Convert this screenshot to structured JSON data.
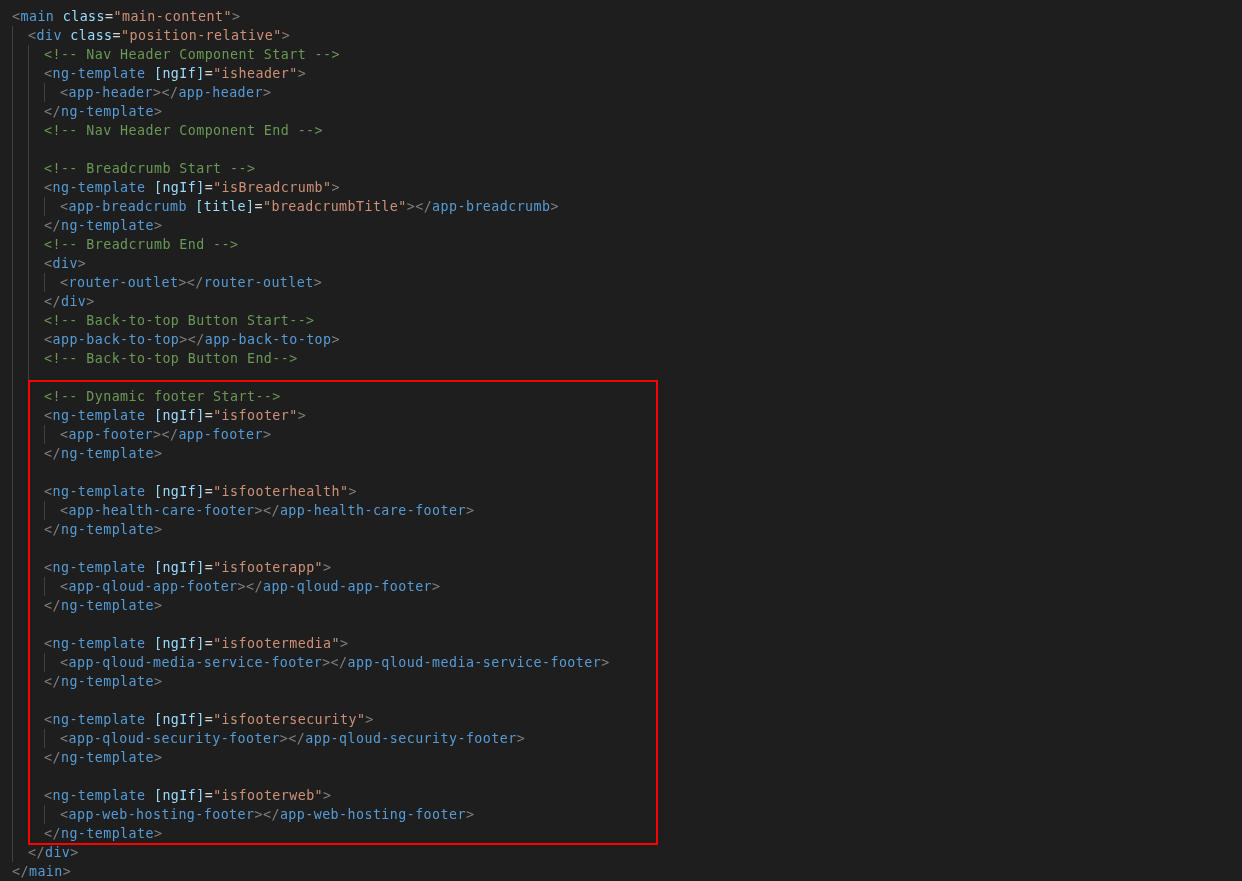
{
  "code": [
    {
      "kind": "line",
      "tokens": [
        {
          "kind": "punct",
          "s": "<"
        },
        {
          "kind": "tag",
          "s": "main"
        },
        {
          "kind": "attr",
          "s": " class"
        },
        {
          "kind": "eq",
          "s": "="
        },
        {
          "kind": "str",
          "s": "\"main-content\""
        },
        {
          "kind": "punct",
          "s": ">"
        }
      ],
      "children": [
        {
          "kind": "line",
          "tokens": [
            {
              "kind": "punct",
              "s": "<"
            },
            {
              "kind": "tag",
              "s": "div"
            },
            {
              "kind": "attr",
              "s": " class"
            },
            {
              "kind": "eq",
              "s": "="
            },
            {
              "kind": "str",
              "s": "\"position-relative\""
            },
            {
              "kind": "punct",
              "s": ">"
            }
          ],
          "children": [
            {
              "kind": "line",
              "tokens": [
                {
                  "kind": "comment",
                  "s": "<!-- Nav Header Component Start -->"
                }
              ]
            },
            {
              "kind": "line",
              "tokens": [
                {
                  "kind": "punct",
                  "s": "<"
                },
                {
                  "kind": "tag",
                  "s": "ng-template"
                },
                {
                  "kind": "attr",
                  "s": " [ngIf]"
                },
                {
                  "kind": "eq",
                  "s": "="
                },
                {
                  "kind": "str",
                  "s": "\"isheader\""
                },
                {
                  "kind": "punct",
                  "s": ">"
                }
              ],
              "children": [
                {
                  "kind": "line",
                  "tokens": [
                    {
                      "kind": "punct",
                      "s": "<"
                    },
                    {
                      "kind": "tag",
                      "s": "app-header"
                    },
                    {
                      "kind": "punct",
                      "s": "></"
                    },
                    {
                      "kind": "tag",
                      "s": "app-header"
                    },
                    {
                      "kind": "punct",
                      "s": ">"
                    }
                  ]
                }
              ]
            },
            {
              "kind": "line",
              "tokens": [
                {
                  "kind": "punct",
                  "s": "</"
                },
                {
                  "kind": "tag",
                  "s": "ng-template"
                },
                {
                  "kind": "punct",
                  "s": ">"
                }
              ]
            },
            {
              "kind": "line",
              "tokens": [
                {
                  "kind": "comment",
                  "s": "<!-- Nav Header Component End -->"
                }
              ]
            },
            {
              "kind": "blank"
            },
            {
              "kind": "line",
              "tokens": [
                {
                  "kind": "comment",
                  "s": "<!-- Breadcrumb Start -->"
                }
              ]
            },
            {
              "kind": "line",
              "tokens": [
                {
                  "kind": "punct",
                  "s": "<"
                },
                {
                  "kind": "tag",
                  "s": "ng-template"
                },
                {
                  "kind": "attr",
                  "s": " [ngIf]"
                },
                {
                  "kind": "eq",
                  "s": "="
                },
                {
                  "kind": "str",
                  "s": "\"isBreadcrumb\""
                },
                {
                  "kind": "punct",
                  "s": ">"
                }
              ],
              "children": [
                {
                  "kind": "line",
                  "tokens": [
                    {
                      "kind": "punct",
                      "s": "<"
                    },
                    {
                      "kind": "tag",
                      "s": "app-breadcrumb"
                    },
                    {
                      "kind": "attr",
                      "s": " [title]"
                    },
                    {
                      "kind": "eq",
                      "s": "="
                    },
                    {
                      "kind": "str",
                      "s": "\"breadcrumbTitle\""
                    },
                    {
                      "kind": "punct",
                      "s": "></"
                    },
                    {
                      "kind": "tag",
                      "s": "app-breadcrumb"
                    },
                    {
                      "kind": "punct",
                      "s": ">"
                    }
                  ]
                }
              ]
            },
            {
              "kind": "line",
              "tokens": [
                {
                  "kind": "punct",
                  "s": "</"
                },
                {
                  "kind": "tag",
                  "s": "ng-template"
                },
                {
                  "kind": "punct",
                  "s": ">"
                }
              ]
            },
            {
              "kind": "line",
              "tokens": [
                {
                  "kind": "comment",
                  "s": "<!-- Breadcrumb End -->"
                }
              ]
            },
            {
              "kind": "line",
              "tokens": [
                {
                  "kind": "punct",
                  "s": "<"
                },
                {
                  "kind": "tag",
                  "s": "div"
                },
                {
                  "kind": "punct",
                  "s": ">"
                }
              ],
              "children": [
                {
                  "kind": "line",
                  "tokens": [
                    {
                      "kind": "punct",
                      "s": "<"
                    },
                    {
                      "kind": "tag",
                      "s": "router-outlet"
                    },
                    {
                      "kind": "punct",
                      "s": "></"
                    },
                    {
                      "kind": "tag",
                      "s": "router-outlet"
                    },
                    {
                      "kind": "punct",
                      "s": ">"
                    }
                  ]
                }
              ]
            },
            {
              "kind": "line",
              "tokens": [
                {
                  "kind": "punct",
                  "s": "</"
                },
                {
                  "kind": "tag",
                  "s": "div"
                },
                {
                  "kind": "punct",
                  "s": ">"
                }
              ]
            },
            {
              "kind": "line",
              "tokens": [
                {
                  "kind": "comment",
                  "s": "<!-- Back-to-top Button Start-->"
                }
              ]
            },
            {
              "kind": "line",
              "tokens": [
                {
                  "kind": "punct",
                  "s": "<"
                },
                {
                  "kind": "tag",
                  "s": "app-back-to-top"
                },
                {
                  "kind": "punct",
                  "s": "></"
                },
                {
                  "kind": "tag",
                  "s": "app-back-to-top"
                },
                {
                  "kind": "punct",
                  "s": ">"
                }
              ]
            },
            {
              "kind": "line",
              "tokens": [
                {
                  "kind": "comment",
                  "s": "<!-- Back-to-top Button End-->"
                }
              ]
            },
            {
              "kind": "blank"
            },
            {
              "kind": "group",
              "highlighted": true,
              "items": [
                {
                  "kind": "line",
                  "tokens": [
                    {
                      "kind": "comment",
                      "s": "<!-- Dynamic footer Start-->"
                    }
                  ]
                },
                {
                  "kind": "line",
                  "tokens": [
                    {
                      "kind": "punct",
                      "s": "<"
                    },
                    {
                      "kind": "tag",
                      "s": "ng-template"
                    },
                    {
                      "kind": "attr",
                      "s": " [ngIf]"
                    },
                    {
                      "kind": "eq",
                      "s": "="
                    },
                    {
                      "kind": "str",
                      "s": "\"isfooter\""
                    },
                    {
                      "kind": "punct",
                      "s": ">"
                    }
                  ],
                  "children": [
                    {
                      "kind": "line",
                      "tokens": [
                        {
                          "kind": "punct",
                          "s": "<"
                        },
                        {
                          "kind": "tag",
                          "s": "app-footer"
                        },
                        {
                          "kind": "punct",
                          "s": "></"
                        },
                        {
                          "kind": "tag",
                          "s": "app-footer"
                        },
                        {
                          "kind": "punct",
                          "s": ">"
                        }
                      ]
                    }
                  ]
                },
                {
                  "kind": "line",
                  "tokens": [
                    {
                      "kind": "punct",
                      "s": "</"
                    },
                    {
                      "kind": "tag",
                      "s": "ng-template"
                    },
                    {
                      "kind": "punct",
                      "s": ">"
                    }
                  ]
                },
                {
                  "kind": "blank"
                },
                {
                  "kind": "line",
                  "tokens": [
                    {
                      "kind": "punct",
                      "s": "<"
                    },
                    {
                      "kind": "tag",
                      "s": "ng-template"
                    },
                    {
                      "kind": "attr",
                      "s": " [ngIf]"
                    },
                    {
                      "kind": "eq",
                      "s": "="
                    },
                    {
                      "kind": "str",
                      "s": "\"isfooterhealth\""
                    },
                    {
                      "kind": "punct",
                      "s": ">"
                    }
                  ],
                  "children": [
                    {
                      "kind": "line",
                      "tokens": [
                        {
                          "kind": "punct",
                          "s": "<"
                        },
                        {
                          "kind": "tag",
                          "s": "app-health-care-footer"
                        },
                        {
                          "kind": "punct",
                          "s": "></"
                        },
                        {
                          "kind": "tag",
                          "s": "app-health-care-footer"
                        },
                        {
                          "kind": "punct",
                          "s": ">"
                        }
                      ]
                    }
                  ]
                },
                {
                  "kind": "line",
                  "tokens": [
                    {
                      "kind": "punct",
                      "s": "</"
                    },
                    {
                      "kind": "tag",
                      "s": "ng-template"
                    },
                    {
                      "kind": "punct",
                      "s": ">"
                    }
                  ]
                },
                {
                  "kind": "blank"
                },
                {
                  "kind": "line",
                  "tokens": [
                    {
                      "kind": "punct",
                      "s": "<"
                    },
                    {
                      "kind": "tag",
                      "s": "ng-template"
                    },
                    {
                      "kind": "attr",
                      "s": " [ngIf]"
                    },
                    {
                      "kind": "eq",
                      "s": "="
                    },
                    {
                      "kind": "str",
                      "s": "\"isfooterapp\""
                    },
                    {
                      "kind": "punct",
                      "s": ">"
                    }
                  ],
                  "children": [
                    {
                      "kind": "line",
                      "tokens": [
                        {
                          "kind": "punct",
                          "s": "<"
                        },
                        {
                          "kind": "tag",
                          "s": "app-qloud-app-footer"
                        },
                        {
                          "kind": "punct",
                          "s": "></"
                        },
                        {
                          "kind": "tag",
                          "s": "app-qloud-app-footer"
                        },
                        {
                          "kind": "punct",
                          "s": ">"
                        }
                      ]
                    }
                  ]
                },
                {
                  "kind": "line",
                  "tokens": [
                    {
                      "kind": "punct",
                      "s": "</"
                    },
                    {
                      "kind": "tag",
                      "s": "ng-template"
                    },
                    {
                      "kind": "punct",
                      "s": ">"
                    }
                  ]
                },
                {
                  "kind": "blank"
                },
                {
                  "kind": "line",
                  "tokens": [
                    {
                      "kind": "punct",
                      "s": "<"
                    },
                    {
                      "kind": "tag",
                      "s": "ng-template"
                    },
                    {
                      "kind": "attr",
                      "s": " [ngIf]"
                    },
                    {
                      "kind": "eq",
                      "s": "="
                    },
                    {
                      "kind": "str",
                      "s": "\"isfootermedia\""
                    },
                    {
                      "kind": "punct",
                      "s": ">"
                    }
                  ],
                  "children": [
                    {
                      "kind": "line",
                      "tokens": [
                        {
                          "kind": "punct",
                          "s": "<"
                        },
                        {
                          "kind": "tag",
                          "s": "app-qloud-media-service-footer"
                        },
                        {
                          "kind": "punct",
                          "s": "></"
                        },
                        {
                          "kind": "tag",
                          "s": "app-qloud-media-service-footer"
                        },
                        {
                          "kind": "punct",
                          "s": ">"
                        }
                      ]
                    }
                  ]
                },
                {
                  "kind": "line",
                  "tokens": [
                    {
                      "kind": "punct",
                      "s": "</"
                    },
                    {
                      "kind": "tag",
                      "s": "ng-template"
                    },
                    {
                      "kind": "punct",
                      "s": ">"
                    }
                  ]
                },
                {
                  "kind": "blank"
                },
                {
                  "kind": "line",
                  "tokens": [
                    {
                      "kind": "punct",
                      "s": "<"
                    },
                    {
                      "kind": "tag",
                      "s": "ng-template"
                    },
                    {
                      "kind": "attr",
                      "s": " [ngIf]"
                    },
                    {
                      "kind": "eq",
                      "s": "="
                    },
                    {
                      "kind": "str",
                      "s": "\"isfootersecurity\""
                    },
                    {
                      "kind": "punct",
                      "s": ">"
                    }
                  ],
                  "children": [
                    {
                      "kind": "line",
                      "tokens": [
                        {
                          "kind": "punct",
                          "s": "<"
                        },
                        {
                          "kind": "tag",
                          "s": "app-qloud-security-footer"
                        },
                        {
                          "kind": "punct",
                          "s": "></"
                        },
                        {
                          "kind": "tag",
                          "s": "app-qloud-security-footer"
                        },
                        {
                          "kind": "punct",
                          "s": ">"
                        }
                      ]
                    }
                  ]
                },
                {
                  "kind": "line",
                  "tokens": [
                    {
                      "kind": "punct",
                      "s": "</"
                    },
                    {
                      "kind": "tag",
                      "s": "ng-template"
                    },
                    {
                      "kind": "punct",
                      "s": ">"
                    }
                  ]
                },
                {
                  "kind": "blank"
                },
                {
                  "kind": "line",
                  "tokens": [
                    {
                      "kind": "punct",
                      "s": "<"
                    },
                    {
                      "kind": "tag",
                      "s": "ng-template"
                    },
                    {
                      "kind": "attr",
                      "s": " [ngIf]"
                    },
                    {
                      "kind": "eq",
                      "s": "="
                    },
                    {
                      "kind": "str",
                      "s": "\"isfooterweb\""
                    },
                    {
                      "kind": "punct",
                      "s": ">"
                    }
                  ],
                  "children": [
                    {
                      "kind": "line",
                      "tokens": [
                        {
                          "kind": "punct",
                          "s": "<"
                        },
                        {
                          "kind": "tag",
                          "s": "app-web-hosting-footer"
                        },
                        {
                          "kind": "punct",
                          "s": "></"
                        },
                        {
                          "kind": "tag",
                          "s": "app-web-hosting-footer"
                        },
                        {
                          "kind": "punct",
                          "s": ">"
                        }
                      ]
                    }
                  ]
                },
                {
                  "kind": "line",
                  "tokens": [
                    {
                      "kind": "punct",
                      "s": "</"
                    },
                    {
                      "kind": "tag",
                      "s": "ng-template"
                    },
                    {
                      "kind": "punct",
                      "s": ">"
                    }
                  ]
                }
              ]
            }
          ]
        },
        {
          "kind": "line",
          "tokens": [
            {
              "kind": "punct",
              "s": "</"
            },
            {
              "kind": "tag",
              "s": "div"
            },
            {
              "kind": "punct",
              "s": ">"
            }
          ]
        }
      ]
    },
    {
      "kind": "line",
      "tokens": [
        {
          "kind": "punct",
          "s": "</"
        },
        {
          "kind": "tag",
          "s": "main"
        },
        {
          "kind": "punct",
          "s": ">"
        }
      ]
    }
  ]
}
